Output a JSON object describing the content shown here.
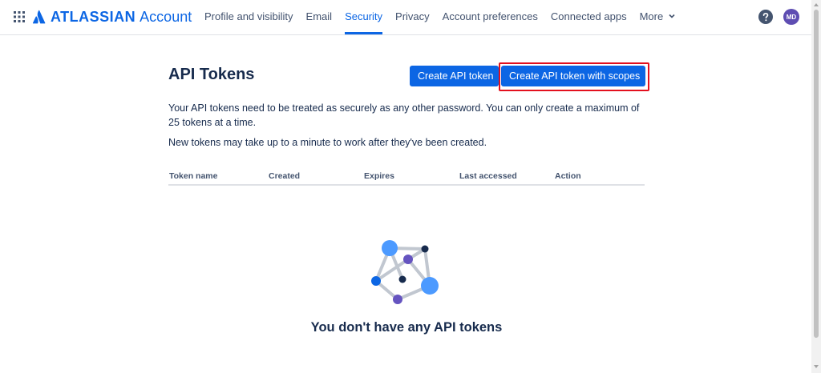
{
  "header": {
    "brand": "ATLASSIAN",
    "product": "Account",
    "nav": [
      {
        "label": "Profile and visibility"
      },
      {
        "label": "Email"
      },
      {
        "label": "Security"
      },
      {
        "label": "Privacy"
      },
      {
        "label": "Account preferences"
      },
      {
        "label": "Connected apps"
      },
      {
        "label": "More"
      }
    ],
    "active_nav": "Security",
    "avatar_initials": "MD",
    "icons": [
      "app-switcher-icon",
      "atlassian-logo-icon",
      "chevron-down-icon",
      "help-icon"
    ]
  },
  "main": {
    "title": "API Tokens",
    "create_button": "Create API token",
    "create_scopes_button": "Create API token with scopes",
    "description_1": "Your API tokens need to be treated as securely as any other password. You can only create a maximum of 25 tokens at a time.",
    "description_2": "New tokens may take up to a minute to work after they've been created.",
    "table": {
      "columns": [
        "Token name",
        "Created",
        "Expires",
        "Last accessed",
        "Action"
      ]
    },
    "empty_state": {
      "text": "You don't have any API tokens",
      "icon": "empty-tokens-illustration-icon"
    }
  },
  "colors": {
    "brand_blue": "#0c66e4",
    "text": "#172b4d",
    "highlight_red": "#e3101e",
    "avatar": "#5e4db2"
  }
}
